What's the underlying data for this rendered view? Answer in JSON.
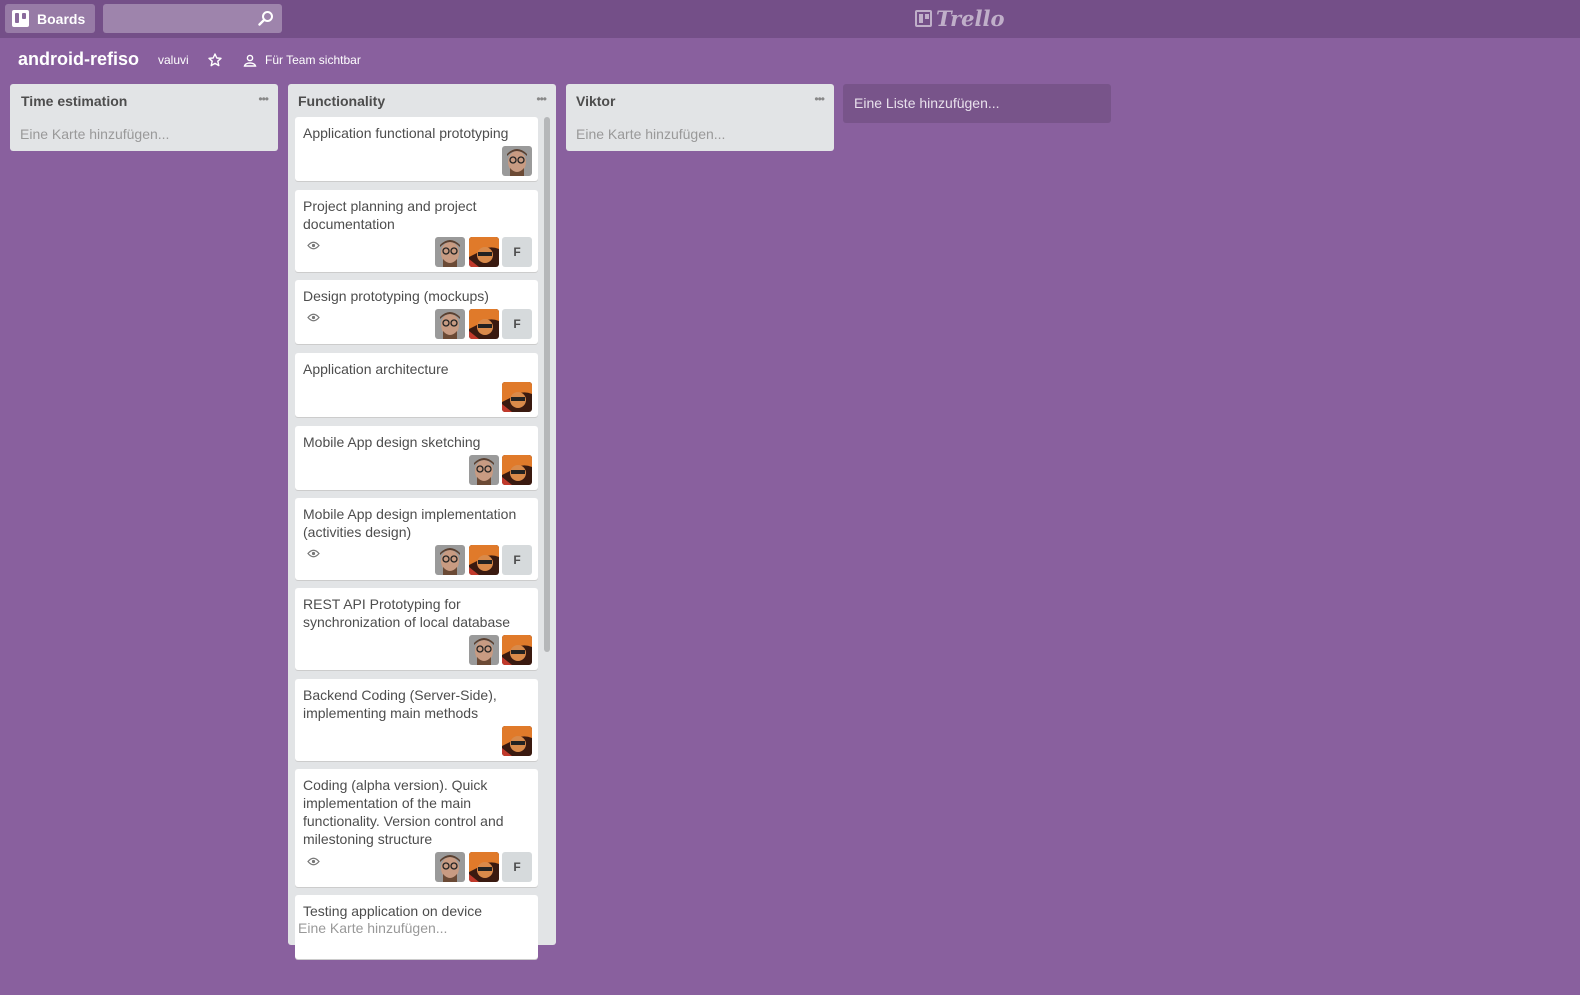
{
  "header": {
    "boards_label": "Boards",
    "search_placeholder": "",
    "logo_text": "Trello"
  },
  "board": {
    "title": "android-refiso",
    "owner": "valuvi",
    "visibility": "Für Team sichtbar"
  },
  "colors": {
    "background": "#89609e",
    "header": "#744f88",
    "list": "#e2e4e6"
  },
  "lists": [
    {
      "title": "Time estimation",
      "add_card": "Eine Karte hinzufügen..."
    },
    {
      "title": "Functionality",
      "add_card": "Eine Karte hinzufügen...",
      "cards": [
        {
          "title": "Application functional prototyping",
          "watched": false,
          "members": [
            "avatar-glasses"
          ]
        },
        {
          "title": "Project planning and project documentation",
          "watched": true,
          "members": [
            "avatar-glasses",
            "avatar-orange",
            "F"
          ]
        },
        {
          "title": "Design prototyping (mockups)",
          "watched": true,
          "members": [
            "avatar-glasses",
            "avatar-orange",
            "F"
          ]
        },
        {
          "title": "Application architecture",
          "watched": false,
          "members": [
            "avatar-orange"
          ]
        },
        {
          "title": "Mobile App design sketching",
          "watched": false,
          "members": [
            "avatar-glasses",
            "avatar-orange"
          ]
        },
        {
          "title": "Mobile App design implementation (activities design)",
          "watched": true,
          "members": [
            "avatar-glasses",
            "avatar-orange",
            "F"
          ]
        },
        {
          "title": "REST API Prototyping for synchronization of local database",
          "watched": false,
          "members": [
            "avatar-glasses",
            "avatar-orange"
          ]
        },
        {
          "title": "Backend Coding (Server-Side), implementing main methods",
          "watched": false,
          "members": [
            "avatar-orange"
          ]
        },
        {
          "title": "Coding (alpha version). Quick implementation of the main functionality. Version control and milestoning structure",
          "watched": true,
          "members": [
            "avatar-glasses",
            "avatar-orange",
            "F"
          ]
        },
        {
          "title": "Testing application on device",
          "watched": false,
          "members": []
        }
      ]
    },
    {
      "title": "Viktor",
      "add_card": "Eine Karte hinzufügen..."
    }
  ],
  "add_list_label": "Eine Liste hinzufügen...",
  "member_initial": "F"
}
